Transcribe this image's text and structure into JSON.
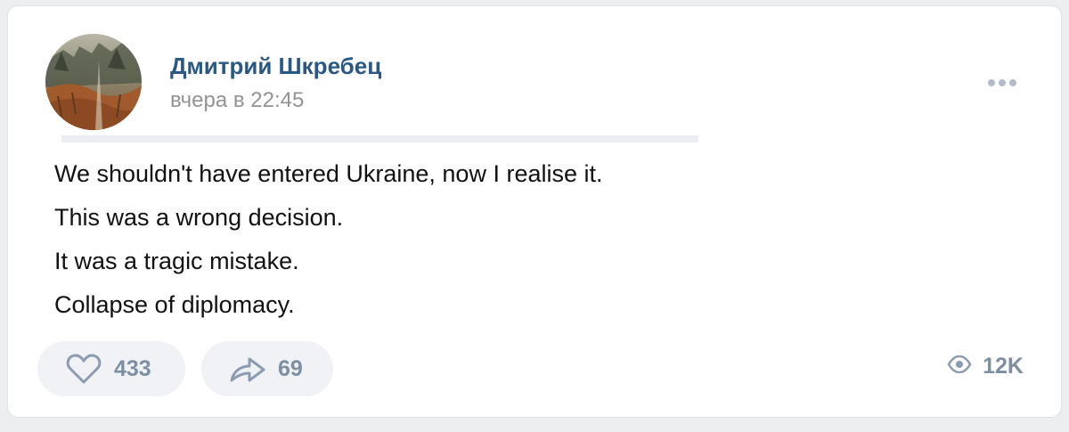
{
  "post": {
    "author": "Дмитрий Шкребец",
    "timestamp": "вчера в 22:45",
    "lines": [
      "We shouldn't have entered Ukraine, now I realise it.",
      "This was a wrong decision.",
      "It was a tragic mistake.",
      "Collapse of diplomacy."
    ],
    "more_icon": "more-horizontal-icon"
  },
  "actions": {
    "likes": "433",
    "shares": "69",
    "views": "12K",
    "like_icon": "heart-icon",
    "share_icon": "share-arrow-icon",
    "views_icon": "eye-icon"
  },
  "colors": {
    "author_link": "#2a5885",
    "secondary_text": "#939393",
    "action_text": "#7d8fa3",
    "pill_background": "#f0f2f5",
    "page_background": "#edeef0"
  }
}
